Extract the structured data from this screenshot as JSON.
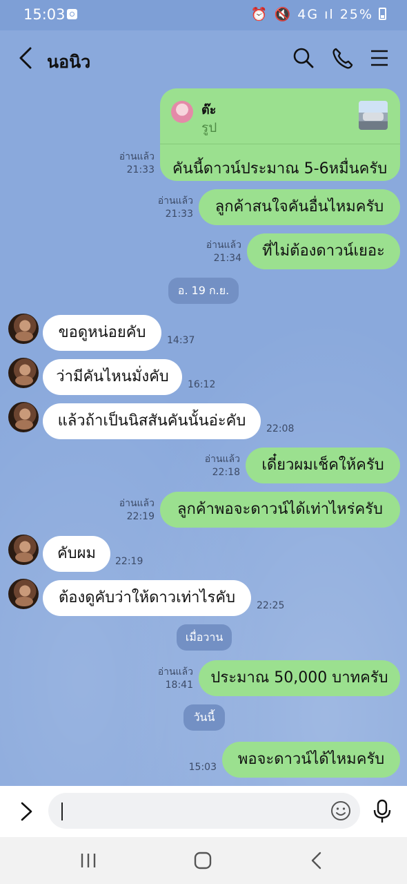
{
  "status_bar": {
    "time": "15:03",
    "icons_text": "⏰ 🔇 4G ıl",
    "battery": "25%"
  },
  "header": {
    "contact_name": "นอนิว",
    "icons": [
      "back-arrow-icon",
      "search-icon",
      "phone-icon",
      "menu-icon"
    ]
  },
  "messages": {
    "m1": {
      "reply_name": "ต๊ะ",
      "reply_type": "รูป",
      "text": "คันนี้ดาวน์ประมาณ 5-6หมื่นครับ",
      "read": "อ่านแล้ว",
      "time": "21:33"
    },
    "m2": {
      "text": "ลูกค้าสนใจคันอื่นไหมครับ",
      "read": "อ่านแล้ว",
      "time": "21:33"
    },
    "m3": {
      "text": "ที่ไม่ต้องดาวน์เยอะ",
      "read": "อ่านแล้ว",
      "time": "21:34"
    },
    "date1": "อ. 19 ก.ย.",
    "m4": {
      "text": "ขอดูหน่อยคับ",
      "time": "14:37"
    },
    "m5": {
      "text": "ว่ามีคันไหนมั่งคับ",
      "time": "16:12"
    },
    "m6": {
      "text": "แล้วถ้าเป็นนิสสันคันนั้นอ่ะคับ",
      "time": "22:08"
    },
    "m7": {
      "text": "เดี๋ยวผมเช็คให้ครับ",
      "read": "อ่านแล้ว",
      "time": "22:18"
    },
    "m8": {
      "text": "ลูกค้าพอจะดาวน์ได้เท่าไหร่ครับ",
      "read": "อ่านแล้ว",
      "time": "22:19"
    },
    "m9": {
      "text": "คับผม",
      "time": "22:19"
    },
    "m10": {
      "text": "ต้องดูคับว่าให้ดาวเท่าไรคับ",
      "time": "22:25"
    },
    "date2": "เมื่อวาน",
    "m11": {
      "text": "ประมาณ 50,000 บาทครับ",
      "read": "อ่านแล้ว",
      "time": "18:41"
    },
    "date3": "วันนี้",
    "m12": {
      "text": "พอจะดาวน์ได้ไหมครับ",
      "time": "15:03"
    }
  },
  "input": {
    "value": ""
  },
  "colors": {
    "chat_background": "#8aa9dc",
    "outgoing_bubble": "#9be08f",
    "incoming_bubble": "#ffffff",
    "date_pill": "#7390c4"
  }
}
